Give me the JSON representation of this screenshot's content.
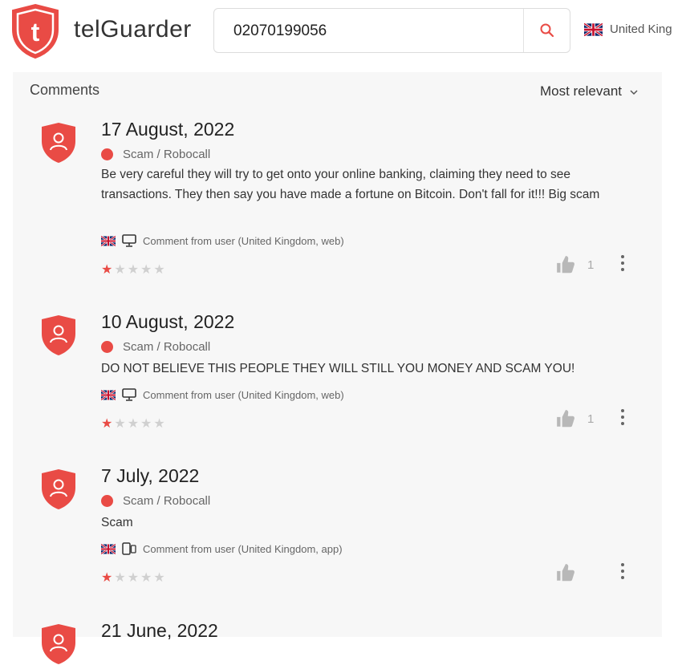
{
  "header": {
    "logo_letter": "t",
    "brand": "telGuarder",
    "search_value": "02070199056",
    "country_label": "United King"
  },
  "colors": {
    "accent": "#e94b45",
    "panel_bg": "#f7f7f7"
  },
  "section": {
    "title": "Comments",
    "sort_label": "Most relevant"
  },
  "comments": [
    {
      "date": "17 August, 2022",
      "category": "Scam / Robocall",
      "text": "Be very careful they will try to get onto your online banking, claiming they need to see transactions. They then say you have made a fortune on Bitcoin. Don't fall for it!!! Big scam",
      "meta": "Comment from user (United Kingdom,  web)",
      "device_icon": "monitor-icon",
      "rating": 1,
      "likes": "1"
    },
    {
      "date": "10 August, 2022",
      "category": "Scam / Robocall",
      "text": "DO NOT BELIEVE THIS PEOPLE THEY WILL STILL YOU MONEY AND SCAM YOU!",
      "meta": "Comment from user (United Kingdom,  web)",
      "device_icon": "monitor-icon",
      "rating": 1,
      "likes": "1"
    },
    {
      "date": "7 July, 2022",
      "category": "Scam / Robocall",
      "text": "Scam",
      "meta": "Comment from user (United Kingdom,  app)",
      "device_icon": "mobile-icon",
      "rating": 1,
      "likes": ""
    },
    {
      "date": "21 June, 2022",
      "partially_visible": true
    }
  ]
}
